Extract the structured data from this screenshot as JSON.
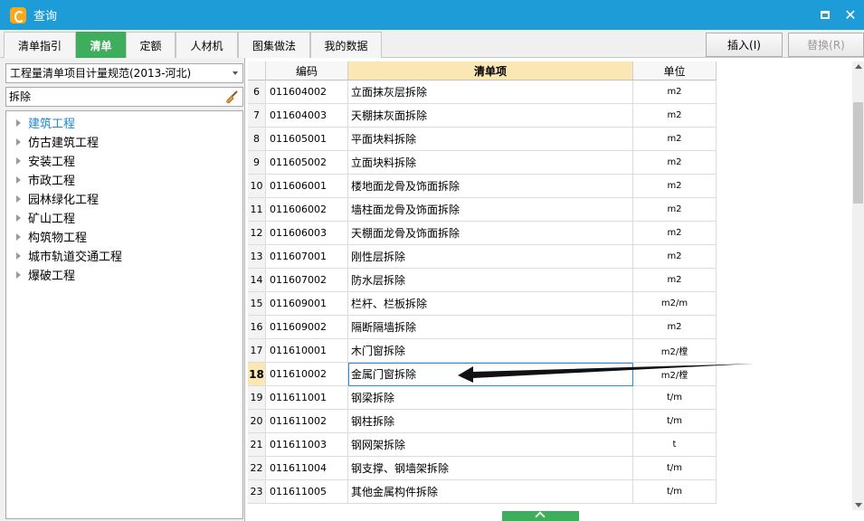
{
  "window": {
    "title": "查询",
    "minimize_icon": "minimize-icon",
    "close_icon": "close-icon"
  },
  "tabs": [
    {
      "label": "清单指引",
      "active": false
    },
    {
      "label": "清单",
      "active": true
    },
    {
      "label": "定额",
      "active": false
    },
    {
      "label": "人材机",
      "active": false
    },
    {
      "label": "图集做法",
      "active": false
    },
    {
      "label": "我的数据",
      "active": false
    }
  ],
  "toolbar": {
    "insert_label": "插入(I)",
    "replace_label": "替换(R)"
  },
  "left": {
    "spec_selected": "工程量清单项目计量规范(2013-河北)",
    "search_value": "拆除",
    "tree": [
      "建筑工程",
      "仿古建筑工程",
      "安装工程",
      "市政工程",
      "园林绿化工程",
      "矿山工程",
      "构筑物工程",
      "城市轨道交通工程",
      "爆破工程"
    ]
  },
  "grid": {
    "headers": {
      "num": "",
      "code": "编码",
      "name": "清单项",
      "unit": "单位"
    },
    "rows": [
      {
        "num": "6",
        "code": "011604002",
        "name": "立面抹灰层拆除",
        "unit": "m2"
      },
      {
        "num": "7",
        "code": "011604003",
        "name": "天棚抹灰面拆除",
        "unit": "m2"
      },
      {
        "num": "8",
        "code": "011605001",
        "name": "平面块料拆除",
        "unit": "m2"
      },
      {
        "num": "9",
        "code": "011605002",
        "name": "立面块料拆除",
        "unit": "m2"
      },
      {
        "num": "10",
        "code": "011606001",
        "name": "楼地面龙骨及饰面拆除",
        "unit": "m2"
      },
      {
        "num": "11",
        "code": "011606002",
        "name": "墙柱面龙骨及饰面拆除",
        "unit": "m2"
      },
      {
        "num": "12",
        "code": "011606003",
        "name": "天棚面龙骨及饰面拆除",
        "unit": "m2"
      },
      {
        "num": "13",
        "code": "011607001",
        "name": "刚性层拆除",
        "unit": "m2"
      },
      {
        "num": "14",
        "code": "011607002",
        "name": "防水层拆除",
        "unit": "m2"
      },
      {
        "num": "15",
        "code": "011609001",
        "name": "栏杆、栏板拆除",
        "unit": "m2/m"
      },
      {
        "num": "16",
        "code": "011609002",
        "name": "隔断隔墙拆除",
        "unit": "m2"
      },
      {
        "num": "17",
        "code": "011610001",
        "name": "木门窗拆除",
        "unit": "m2/樘"
      },
      {
        "num": "18",
        "code": "011610002",
        "name": "金属门窗拆除",
        "unit": "m2/樘"
      },
      {
        "num": "19",
        "code": "011611001",
        "name": "钢梁拆除",
        "unit": "t/m"
      },
      {
        "num": "20",
        "code": "011611002",
        "name": "钢柱拆除",
        "unit": "t/m"
      },
      {
        "num": "21",
        "code": "011611003",
        "name": "钢网架拆除",
        "unit": "t"
      },
      {
        "num": "22",
        "code": "011611004",
        "name": "钢支撑、钢墙架拆除",
        "unit": "t/m"
      },
      {
        "num": "23",
        "code": "011611005",
        "name": "其他金属构件拆除",
        "unit": "t/m"
      }
    ],
    "current_row_num": "18"
  },
  "colors": {
    "title_bar": "#1e9cd7",
    "active_tab": "#3fae5c",
    "header_highlight": "#fbe7b3",
    "selected_tree_item": "#1e88d8"
  }
}
